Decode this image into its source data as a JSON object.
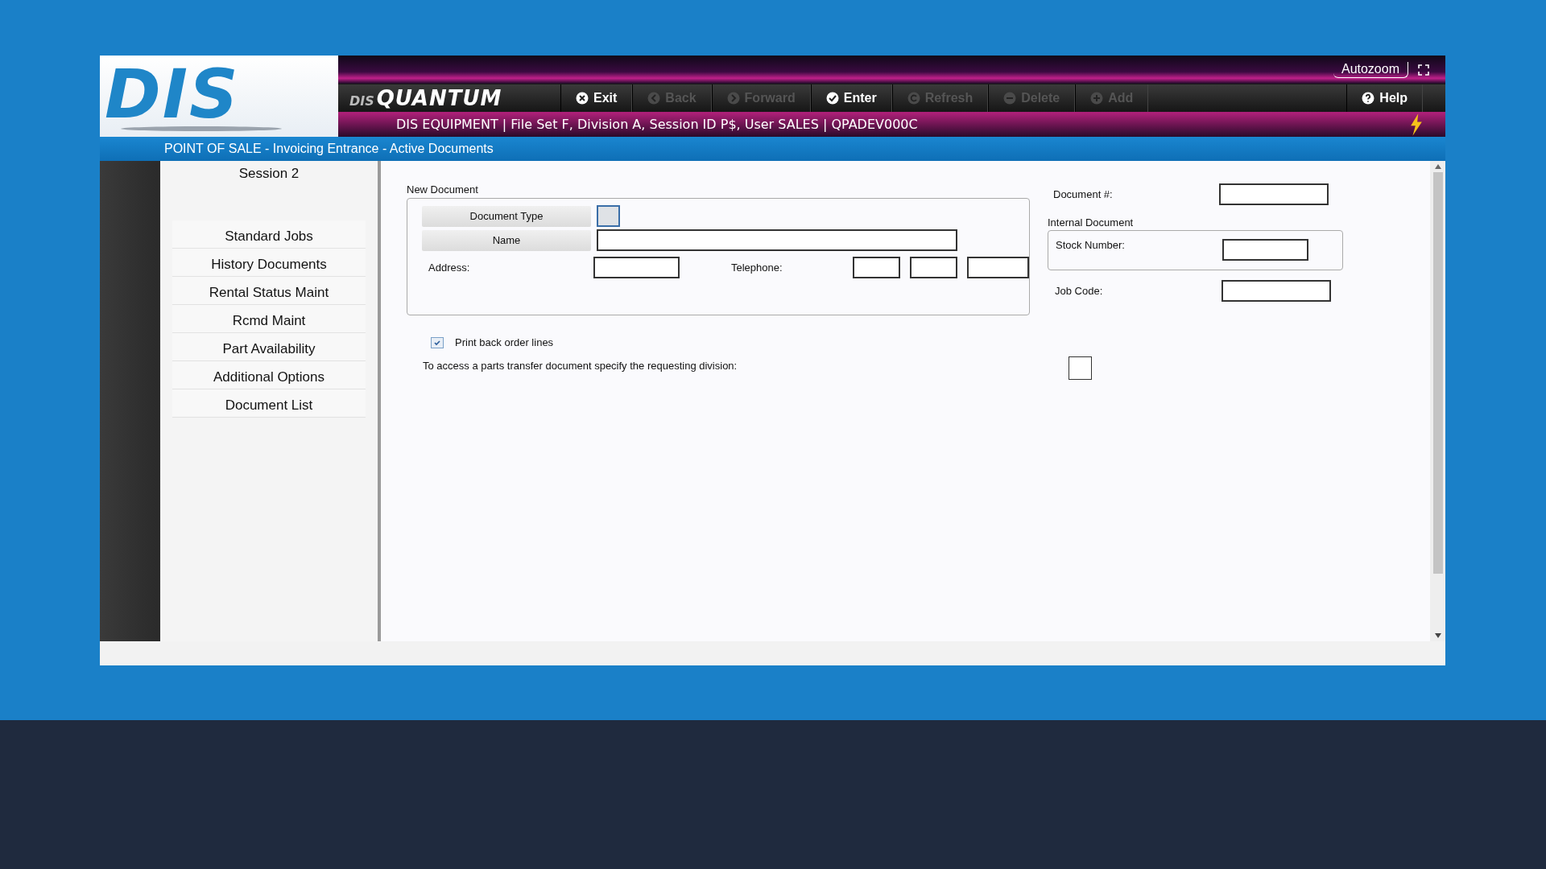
{
  "brand": {
    "logo": "DIS",
    "product_prefix": "DIS",
    "product": "QUANTUM"
  },
  "toolbar": [
    {
      "label": "Exit",
      "kind": "close",
      "disabled": false
    },
    {
      "label": "Back",
      "kind": "back",
      "disabled": true
    },
    {
      "label": "Forward",
      "kind": "forward",
      "disabled": true
    },
    {
      "label": "Enter",
      "kind": "check",
      "disabled": false
    },
    {
      "label": "Refresh",
      "kind": "refresh",
      "disabled": true
    },
    {
      "label": "Delete",
      "kind": "minus",
      "disabled": true
    },
    {
      "label": "Add",
      "kind": "plus",
      "disabled": true
    }
  ],
  "help": {
    "label": "Help"
  },
  "autozoom": {
    "label": "Autozoom"
  },
  "session_info": "DIS EQUIPMENT | File Set F, Division A, Session ID P$, User SALES | QPADEV000C",
  "title": "POINT OF SALE - Invoicing Entrance - Active Documents",
  "sidebar": {
    "header": "Session 2",
    "items": [
      {
        "label": "Standard Jobs"
      },
      {
        "label": "History Documents"
      },
      {
        "label": "Rental Status Maint"
      },
      {
        "label": "Rcmd Maint"
      },
      {
        "label": "Part Availability"
      },
      {
        "label": "Additional Options"
      },
      {
        "label": "Document List"
      }
    ]
  },
  "new_document": {
    "legend": "New Document",
    "document_type": "Document Type",
    "name": "Name",
    "address": "Address:",
    "telephone": "Telephone:"
  },
  "document_number": "Document #:",
  "internal_document": {
    "legend": "Internal Document",
    "stock_number": "Stock Number:"
  },
  "job_code": "Job Code:",
  "print_back_order": {
    "label": "Print back order lines",
    "checked": true
  },
  "transfer_prompt": "To access a parts transfer document specify the requesting division:"
}
